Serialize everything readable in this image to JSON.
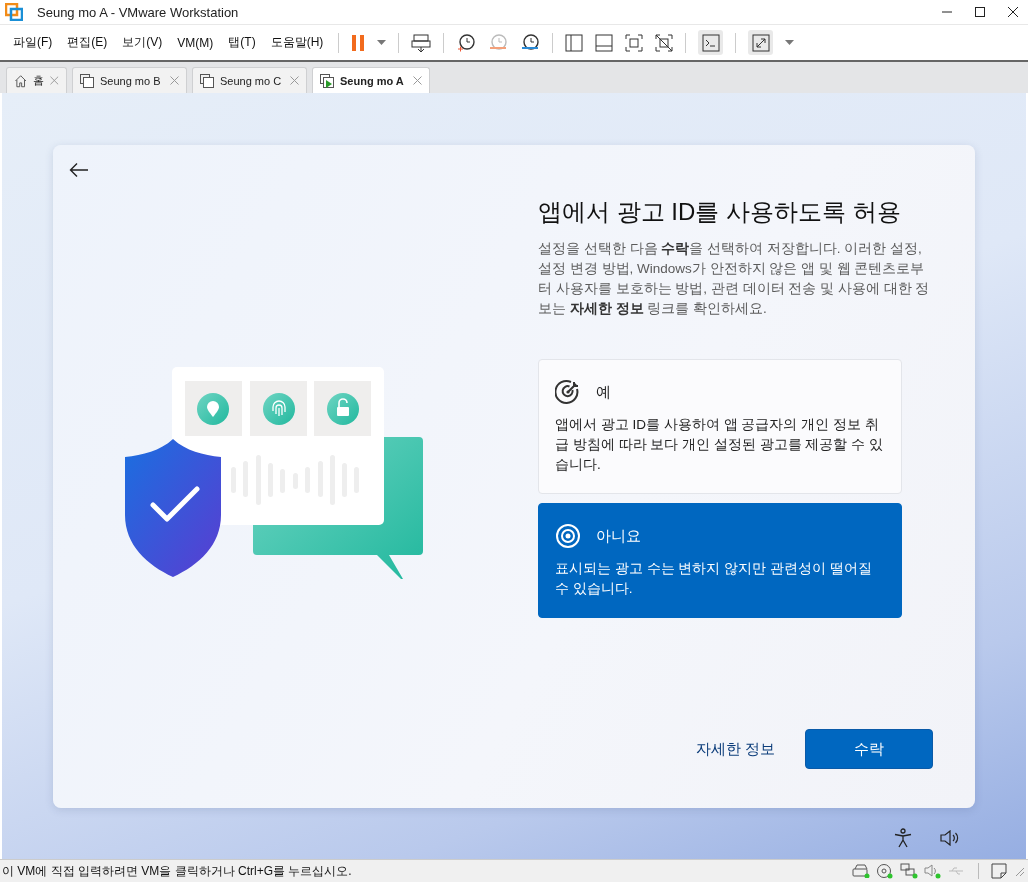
{
  "window": {
    "title": "Seung mo A - VMware Workstation"
  },
  "menu": [
    "파일(F)",
    "편집(E)",
    "보기(V)",
    "VM(M)",
    "탭(T)",
    "도움말(H)"
  ],
  "tabs": [
    {
      "label": "홈",
      "kind": "home",
      "selected": false
    },
    {
      "label": "Seung mo B",
      "kind": "vm",
      "selected": false
    },
    {
      "label": "Seung mo C",
      "kind": "vm",
      "selected": false
    },
    {
      "label": "Seung mo A",
      "kind": "running",
      "selected": true
    }
  ],
  "dialog": {
    "title": "앱에서 광고 ID를 사용하도록 허용",
    "description": "설정을 선택한 다음 **수락**을 선택하여 저장합니다. 이러한 설정, 설정 변경 방법, Windows가 안전하지 않은 앱 및 웹 콘텐츠로부터 사용자를 보호하는 방법, 관련 데이터 전송 및 사용에 대한 정보는 **자세한 정보** 링크를 확인하세요.",
    "options": [
      {
        "kind": "target",
        "title": "예",
        "description": "앱에서 광고 ID를 사용하여 앱 공급자의 개인 정보 취급 방침에 따라 보다 개인 설정된 광고를 제공할 수 있습니다.",
        "selected": false
      },
      {
        "kind": "radio",
        "title": "아니요",
        "description": "표시되는 광고 수는 변하지 않지만 관련성이 떨어질 수 있습니다.",
        "selected": true
      }
    ],
    "link": "자세한 정보",
    "accept_button": "수락"
  },
  "status_bar": {
    "message": "이 VM에 직접 입력하려면 VM을 클릭하거나 Ctrl+G를 누르십시오."
  }
}
